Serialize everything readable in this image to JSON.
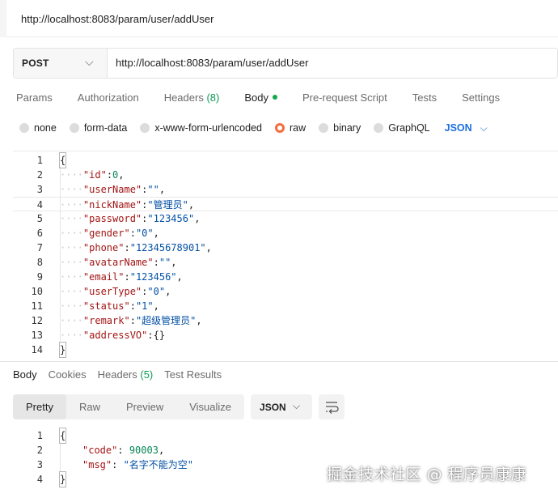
{
  "tab": {
    "title": "http://localhost:8083/param/user/addUser"
  },
  "request": {
    "method": "POST",
    "url": "http://localhost:8083/param/user/addUser"
  },
  "request_tabs": {
    "params": "Params",
    "authorization": "Authorization",
    "headers": "Headers",
    "headers_count": "(8)",
    "body": "Body",
    "prerequest": "Pre-request Script",
    "tests": "Tests",
    "settings": "Settings"
  },
  "body_types": {
    "none": "none",
    "form_data": "form-data",
    "urlencoded": "x-www-form-urlencoded",
    "raw": "raw",
    "binary": "binary",
    "graphql": "GraphQL",
    "format": "JSON"
  },
  "request_body": {
    "line_numbers": [
      "1",
      "2",
      "3",
      "4",
      "5",
      "6",
      "7",
      "8",
      "9",
      "10",
      "11",
      "12",
      "13",
      "14"
    ],
    "lines": [
      {
        "k": "",
        "v": ""
      },
      {
        "k": "\"id\"",
        "sep": ":",
        "v": "0",
        "t": "num",
        "end": ","
      },
      {
        "k": "\"userName\"",
        "sep": ":",
        "v": "\"\"",
        "t": "str",
        "end": ","
      },
      {
        "k": "\"nickName\"",
        "sep": ":",
        "v": "\"管理员\"",
        "t": "str",
        "end": ","
      },
      {
        "k": "\"password\"",
        "sep": ":",
        "v": "\"123456\"",
        "t": "str",
        "end": ","
      },
      {
        "k": "\"gender\"",
        "sep": ":",
        "v": "\"0\"",
        "t": "str",
        "end": ","
      },
      {
        "k": "\"phone\"",
        "sep": ":",
        "v": "\"12345678901\"",
        "t": "str",
        "end": ","
      },
      {
        "k": "\"avatarName\"",
        "sep": ":",
        "v": "\"\"",
        "t": "str",
        "end": ","
      },
      {
        "k": "\"email\"",
        "sep": ":",
        "v": "\"123456\"",
        "t": "str",
        "end": ","
      },
      {
        "k": "\"userType\"",
        "sep": ":",
        "v": "\"0\"",
        "t": "str",
        "end": ","
      },
      {
        "k": "\"status\"",
        "sep": ":",
        "v": "\"1\"",
        "t": "str",
        "end": ","
      },
      {
        "k": "\"remark\"",
        "sep": ":",
        "v": "\"超级管理员\"",
        "t": "str",
        "end": ","
      },
      {
        "k": "\"addressVO\"",
        "sep": ":",
        "v": "{}",
        "t": "plain",
        "end": ""
      },
      {
        "k": "",
        "v": ""
      }
    ],
    "open_brace": "{",
    "close_brace": "}",
    "indent_dots": "····"
  },
  "response_tabs": {
    "body": "Body",
    "cookies": "Cookies",
    "headers": "Headers",
    "headers_count": "(5)",
    "test_results": "Test Results"
  },
  "response_view": {
    "pretty": "Pretty",
    "raw": "Raw",
    "preview": "Preview",
    "visualize": "Visualize",
    "format": "JSON"
  },
  "response_body": {
    "line_numbers": [
      "1",
      "2",
      "3",
      "4"
    ],
    "open_brace": "{",
    "close_brace": "}",
    "code_key": "\"code\"",
    "code_value": "90003",
    "msg_key": "\"msg\"",
    "msg_value": "\"名字不能为空\""
  },
  "watermark": "掘金技术社区 @ 程序员康康"
}
